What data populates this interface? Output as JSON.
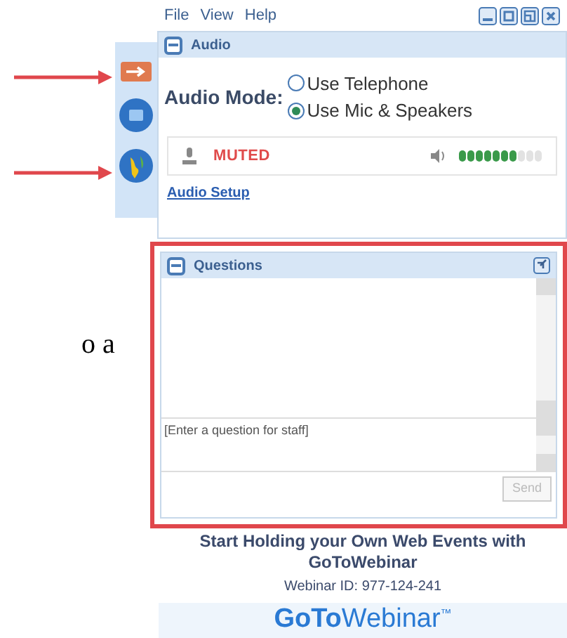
{
  "document": {
    "text": "o a"
  },
  "menu": [
    "File",
    "View",
    "Help"
  ],
  "audio": {
    "title": "Audio",
    "expanded": true,
    "mode_label": "Audio Mode:",
    "options": [
      {
        "label": "Use Telephone",
        "selected": false
      },
      {
        "label": "Use Mic & Speakers",
        "selected": true
      }
    ],
    "mic_status": "MUTED",
    "muted": true,
    "level": 0.7,
    "setup_link": "Audio Setup"
  },
  "questions": {
    "title": "Questions",
    "expanded": true,
    "placeholder": "[Enter a question for staff]",
    "send": {
      "label": "Send",
      "disabled": true
    }
  },
  "footer": {
    "promo": "Start Holding your Own Web Events with GoToWebinar",
    "webinar_id": "Webinar ID: 977-124-241",
    "logo": {
      "bold": "GoTo",
      "regular": "Webinar",
      "mark": "™"
    }
  }
}
